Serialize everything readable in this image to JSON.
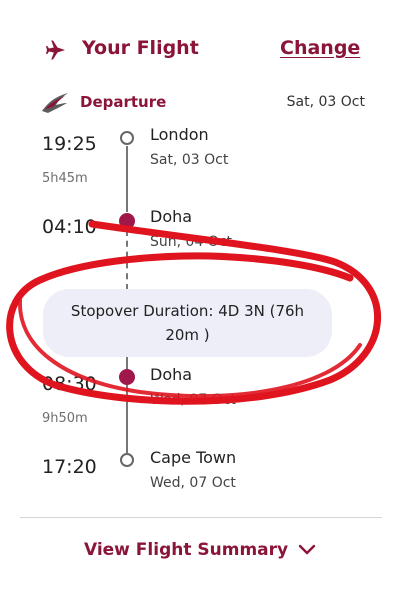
{
  "header": {
    "title": "Your Flight",
    "change_label": "Change"
  },
  "departure": {
    "label": "Departure",
    "date": "Sat, 03 Oct"
  },
  "segments": [
    {
      "time": "19:25",
      "city": "London",
      "date": "Sat, 03 Oct",
      "duration_after": "5h45m"
    },
    {
      "time": "04:10",
      "city": "Doha",
      "date": "Sun, 04 Oct"
    },
    {
      "time": "08:30",
      "city": "Doha",
      "date": "Wed, 07 Oct",
      "duration_after": "9h50m"
    },
    {
      "time": "17:20",
      "city": "Cape Town",
      "date": "Wed, 07 Oct"
    }
  ],
  "stopover": {
    "line1": "Stopover Duration: 4D 3N (76h",
    "line2": "20m )"
  },
  "footer": {
    "summary_label": "View Flight Summary"
  },
  "colors": {
    "brand": "#8a1538",
    "dot": "#a0174a",
    "annotation": "#e0141f"
  }
}
